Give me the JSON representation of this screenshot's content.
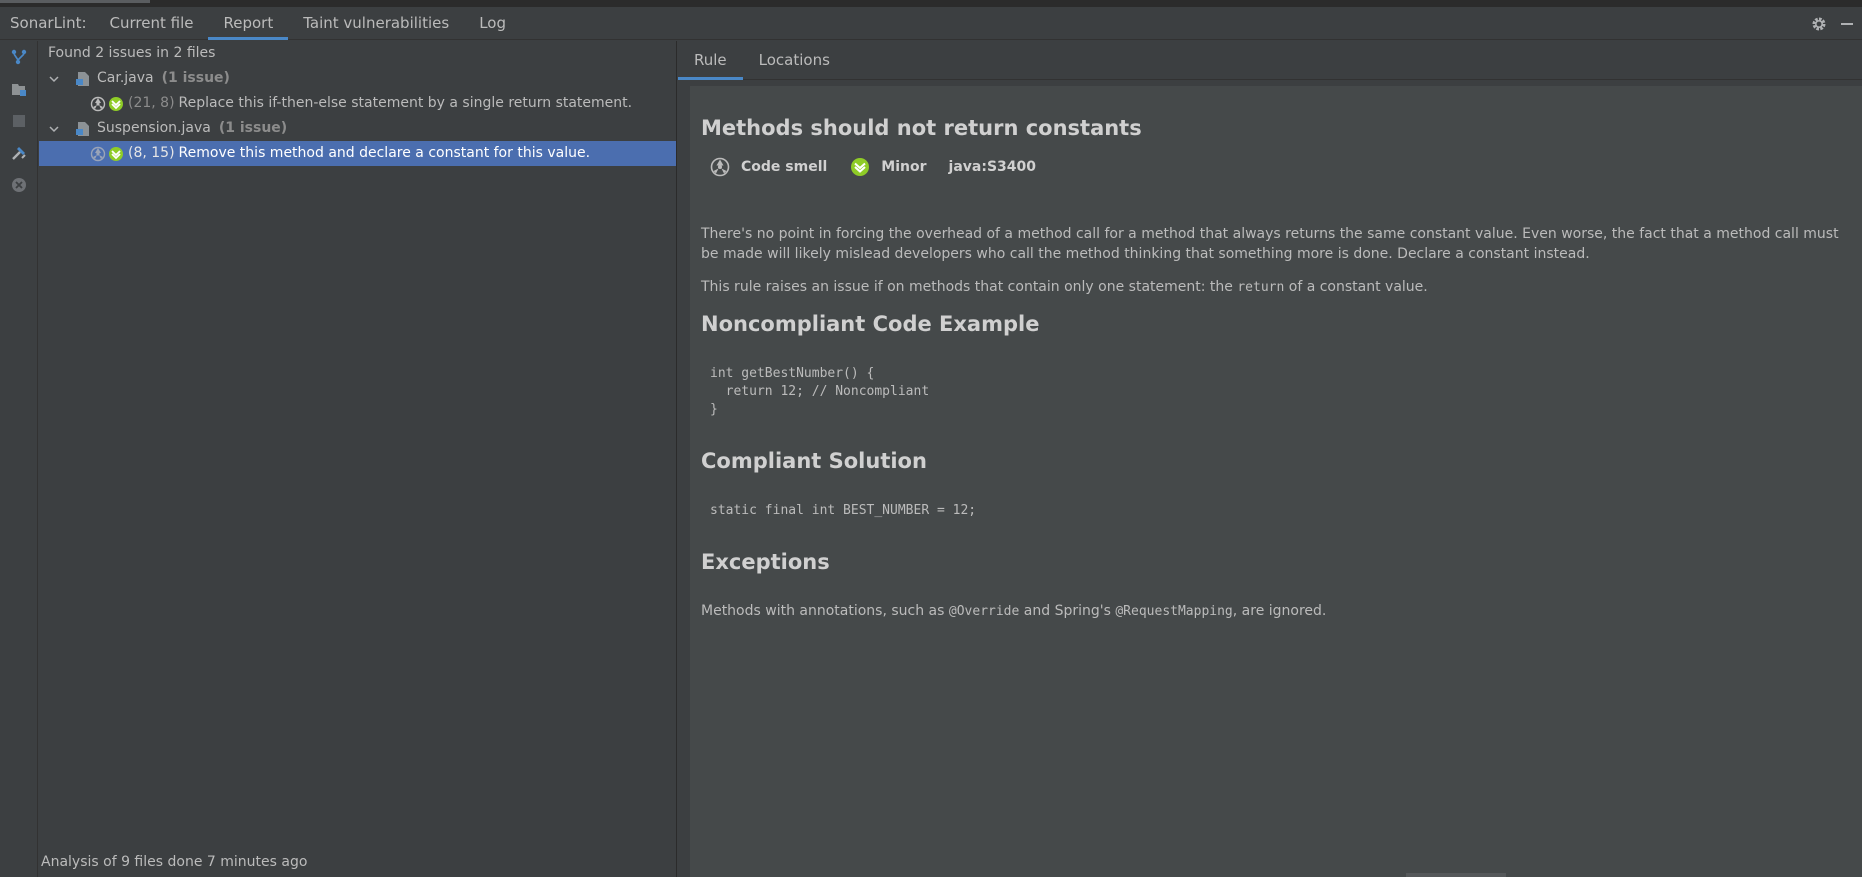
{
  "header": {
    "title": "SonarLint:",
    "tabs": [
      {
        "label": "Current file"
      },
      {
        "label": "Report"
      },
      {
        "label": "Taint vulnerabilities"
      },
      {
        "label": "Log"
      }
    ]
  },
  "toolbar": {
    "buttons": [
      "vcs-branch-icon",
      "folder-scope-icon",
      "stop-icon",
      "tools-icon",
      "clear-icon"
    ]
  },
  "tree": {
    "summary": "Found 2 issues in 2 files",
    "files": [
      {
        "name": "Car.java",
        "count": "(1 issue)",
        "issues": [
          {
            "pos": "(21, 8)",
            "message": "Replace this if-then-else statement by a single return statement."
          }
        ]
      },
      {
        "name": "Suspension.java",
        "count": "(1 issue)",
        "issues": [
          {
            "pos": "(8, 15)",
            "message": "Remove this method and declare a constant for this value."
          }
        ]
      }
    ],
    "status": "Analysis of 9 files done 7 minutes ago"
  },
  "details": {
    "tabs": [
      {
        "label": "Rule"
      },
      {
        "label": "Locations"
      }
    ],
    "rule_title": "Methods should not return constants",
    "type": "Code smell",
    "severity": "Minor",
    "rule_key": "java:S3400",
    "para1": "There's no point in forcing the overhead of a method call for a method that always returns the same constant value. Even worse, the fact that a method call must be made will likely mislead developers who call the method thinking that something more is done. Declare a constant instead.",
    "para2_before": "This rule raises an issue if on methods that contain only one statement: the ",
    "para2_code": "return",
    "para2_after": " of a constant value.",
    "noncompliant_heading": "Noncompliant Code Example",
    "noncompliant_code": "int getBestNumber() {\n  return 12; // Noncompliant\n}",
    "compliant_heading": "Compliant Solution",
    "compliant_code": "static final int BEST_NUMBER = 12;",
    "exceptions_heading": "Exceptions",
    "exc_part1": "Methods with annotations, such as ",
    "exc_code1": "@Override",
    "exc_part2": " and Spring's ",
    "exc_code2": "@RequestMapping",
    "exc_part3": ", are ignored."
  },
  "colors": {
    "accent": "#4a88c7",
    "selection": "#4b6eaf",
    "minor_severity": "#8fcc27",
    "background": "#3c3f41",
    "description_bg": "#45494a"
  }
}
